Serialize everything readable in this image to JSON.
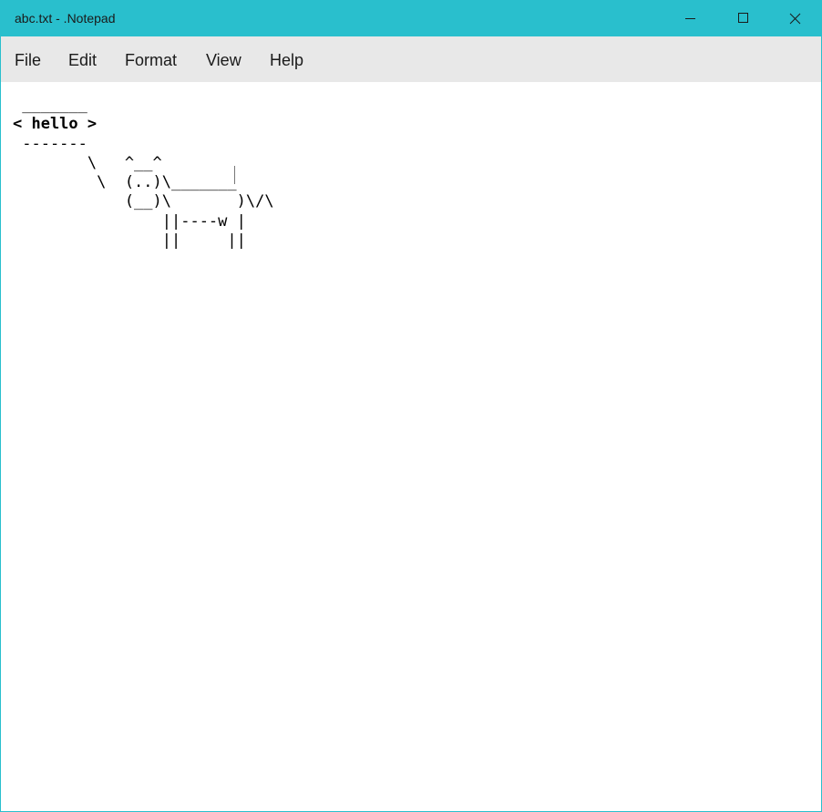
{
  "window": {
    "title": "abc.txt - .Notepad",
    "accent_color": "#29bfcd",
    "controls": {
      "minimize_icon": "minimize-icon",
      "maximize_icon": "maximize-icon",
      "close_icon": "close-icon"
    }
  },
  "menu": {
    "items": [
      {
        "label": "File"
      },
      {
        "label": "Edit"
      },
      {
        "label": "Format"
      },
      {
        "label": "View"
      },
      {
        "label": "Help"
      }
    ]
  },
  "editor": {
    "lines": [
      " _______",
      "< hello >",
      " -------",
      "        \\   ^__^",
      "         \\  (..)\\_______",
      "            (__)\\       )\\/\\",
      "                ||----w |",
      "                ||     ||"
    ]
  }
}
